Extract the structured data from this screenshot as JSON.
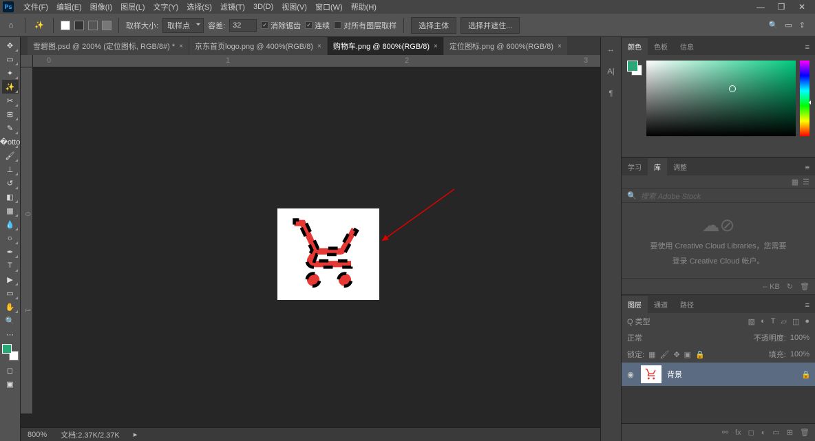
{
  "menu": {
    "items": [
      "文件(F)",
      "编辑(E)",
      "图像(I)",
      "图层(L)",
      "文字(Y)",
      "选择(S)",
      "滤镜(T)",
      "3D(D)",
      "视图(V)",
      "窗口(W)",
      "帮助(H)"
    ],
    "ps": "Ps"
  },
  "window": {
    "min": "—",
    "max": "❐",
    "close": "✕"
  },
  "optbar": {
    "sample_size_lbl": "取样大小:",
    "sample_size_val": "取样点",
    "tolerance_lbl": "容差:",
    "tolerance_val": "32",
    "antialias": "消除锯齿",
    "contiguous": "连续",
    "allLayers": "对所有图层取样",
    "select_subject": "选择主体",
    "select_mask": "选择并遮住..."
  },
  "tabs": [
    {
      "label": "雪碧图.psd @ 200% (定位图标, RGB/8#) *"
    },
    {
      "label": "京东首页logo.png @ 400%(RGB/8)"
    },
    {
      "label": "购物车.png @ 800%(RGB/8)"
    },
    {
      "label": "定位图标.png @ 600%(RGB/8)"
    }
  ],
  "activeTab": 2,
  "ruler": {
    "h": [
      "0",
      "1",
      "2",
      "3"
    ],
    "v": [
      "0",
      "1"
    ]
  },
  "status": {
    "zoom": "800%",
    "doc": "文档:2.37K/2.37K"
  },
  "rightTabs": {
    "color": "颜色",
    "swatches": "色板",
    "info": "信息",
    "learn": "学习",
    "lib": "库",
    "adjust": "调整",
    "layers": "图层",
    "channels": "通道",
    "paths": "路径"
  },
  "lib": {
    "search_ph": "搜索 Adobe Stock",
    "msg1": "要使用 Creative Cloud Libraries，您需要",
    "msg2": "登录 Creative Cloud 帐户。",
    "kb": "-- KB"
  },
  "layers": {
    "kind": "Q 类型",
    "blend": "正常",
    "opacity_lbl": "不透明度:",
    "opacity": "100%",
    "lock_lbl": "锁定:",
    "fill_lbl": "填充:",
    "fill": "100%",
    "bg_name": "背景"
  }
}
